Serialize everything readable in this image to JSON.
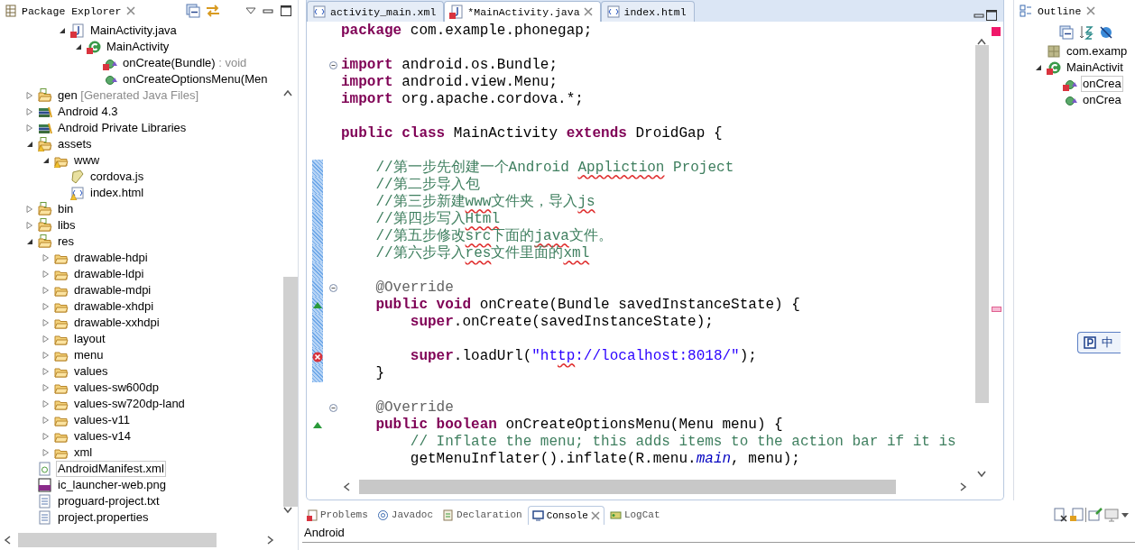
{
  "package_explorer": {
    "title": "Package Explorer",
    "scrolled_items": [
      {
        "label": "MainActivity.java",
        "kind": "java-file",
        "error": true,
        "warning": false,
        "selected": false,
        "expanded": true,
        "children": [
          {
            "label": "MainActivity",
            "kind": "class",
            "error": true,
            "warning": false,
            "selected": false,
            "expanded": true,
            "children": [
              {
                "label": "onCreate(Bundle)",
                "detail": " : void",
                "kind": "method",
                "error": true,
                "warning": false,
                "selected": false
              },
              {
                "label": "onCreateOptionsMenu(Men",
                "kind": "method",
                "error": false,
                "warning": false,
                "selected": false
              }
            ]
          }
        ]
      }
    ],
    "items": [
      {
        "label": "gen",
        "detail": " [Generated Java Files]",
        "kind": "source-folder",
        "error": false,
        "warning": false,
        "selected": false,
        "expanded": false
      },
      {
        "label": "Android 4.3",
        "kind": "library",
        "error": false,
        "warning": false,
        "selected": false,
        "expanded": false
      },
      {
        "label": "Android Private Libraries",
        "kind": "library",
        "error": false,
        "warning": false,
        "selected": false,
        "expanded": false
      },
      {
        "label": "assets",
        "kind": "source-folder",
        "error": false,
        "warning": true,
        "selected": false,
        "expanded": true,
        "children": [
          {
            "label": "www",
            "kind": "folder",
            "error": false,
            "warning": true,
            "selected": false,
            "expanded": true,
            "children": [
              {
                "label": "cordova.js",
                "kind": "js-file",
                "error": false,
                "warning": false,
                "selected": false
              },
              {
                "label": "index.html",
                "kind": "html-file",
                "error": false,
                "warning": true,
                "selected": false
              }
            ]
          }
        ]
      },
      {
        "label": "bin",
        "kind": "source-folder",
        "error": false,
        "warning": false,
        "selected": false,
        "expanded": false
      },
      {
        "label": "libs",
        "kind": "source-folder",
        "error": false,
        "warning": false,
        "selected": false,
        "expanded": false
      },
      {
        "label": "res",
        "kind": "source-folder",
        "error": false,
        "warning": false,
        "selected": false,
        "expanded": true,
        "children": [
          {
            "label": "drawable-hdpi",
            "kind": "folder",
            "error": false,
            "warning": false,
            "selected": false,
            "expanded": false
          },
          {
            "label": "drawable-ldpi",
            "kind": "folder",
            "error": false,
            "warning": false,
            "selected": false,
            "expanded": false
          },
          {
            "label": "drawable-mdpi",
            "kind": "folder",
            "error": false,
            "warning": false,
            "selected": false,
            "expanded": false
          },
          {
            "label": "drawable-xhdpi",
            "kind": "folder",
            "error": false,
            "warning": false,
            "selected": false,
            "expanded": false
          },
          {
            "label": "drawable-xxhdpi",
            "kind": "folder",
            "error": false,
            "warning": false,
            "selected": false,
            "expanded": false
          },
          {
            "label": "layout",
            "kind": "folder",
            "error": false,
            "warning": false,
            "selected": false,
            "expanded": false
          },
          {
            "label": "menu",
            "kind": "folder",
            "error": false,
            "warning": false,
            "selected": false,
            "expanded": false
          },
          {
            "label": "values",
            "kind": "folder",
            "error": false,
            "warning": false,
            "selected": false,
            "expanded": false
          },
          {
            "label": "values-sw600dp",
            "kind": "folder",
            "error": false,
            "warning": false,
            "selected": false,
            "expanded": false
          },
          {
            "label": "values-sw720dp-land",
            "kind": "folder",
            "error": false,
            "warning": false,
            "selected": false,
            "expanded": false
          },
          {
            "label": "values-v11",
            "kind": "folder",
            "error": false,
            "warning": false,
            "selected": false,
            "expanded": false
          },
          {
            "label": "values-v14",
            "kind": "folder",
            "error": false,
            "warning": false,
            "selected": false,
            "expanded": false
          },
          {
            "label": "xml",
            "kind": "folder",
            "error": false,
            "warning": false,
            "selected": false,
            "expanded": false
          }
        ]
      },
      {
        "label": "AndroidManifest.xml",
        "kind": "manifest",
        "error": false,
        "warning": false,
        "selected": true
      },
      {
        "label": "ic_launcher-web.png",
        "kind": "image-file",
        "error": false,
        "warning": false,
        "selected": false
      },
      {
        "label": "proguard-project.txt",
        "kind": "text-file",
        "error": false,
        "warning": false,
        "selected": false
      },
      {
        "label": "project.properties",
        "kind": "text-file",
        "error": false,
        "warning": false,
        "selected": false
      }
    ]
  },
  "editor": {
    "tabs": [
      {
        "label": "activity_main.xml",
        "kind": "xml-file",
        "error": false,
        "selected": false
      },
      {
        "label": "*MainActivity.java",
        "kind": "java-file",
        "error": true,
        "selected": true
      },
      {
        "label": "index.html",
        "kind": "html-file",
        "error": false,
        "selected": false
      }
    ],
    "lines": [
      {
        "kind": "plain",
        "changed": false,
        "tokens": [
          {
            "text": "package",
            "kind": "keyword"
          },
          {
            "text": " com.example.phonegap;",
            "kind": "plain"
          }
        ]
      },
      {
        "kind": "plain",
        "changed": false
      },
      {
        "kind": "fold",
        "changed": false,
        "tokens": [
          {
            "text": "import",
            "kind": "keyword"
          },
          {
            "text": " android.os.Bundle;",
            "kind": "plain"
          }
        ]
      },
      {
        "kind": "plain",
        "changed": false,
        "tokens": [
          {
            "text": "import",
            "kind": "keyword"
          },
          {
            "text": " android.view.Menu;",
            "kind": "plain"
          }
        ]
      },
      {
        "kind": "plain",
        "changed": false,
        "tokens": [
          {
            "text": "import",
            "kind": "keyword"
          },
          {
            "text": " org.apache.cordova.*;",
            "kind": "plain"
          }
        ]
      },
      {
        "kind": "plain",
        "changed": false
      },
      {
        "kind": "plain",
        "changed": false,
        "tokens": [
          {
            "text": "public class",
            "kind": "keyword"
          },
          {
            "text": " MainActivity ",
            "kind": "plain"
          },
          {
            "text": "extends",
            "kind": "keyword"
          },
          {
            "text": " DroidGap {",
            "kind": "plain"
          }
        ]
      },
      {
        "kind": "plain",
        "changed": false
      },
      {
        "kind": "plain",
        "changed": true,
        "tokens": [
          {
            "text": "    //第一步先创建一个Android ",
            "kind": "comment",
            "misspelled": false
          },
          {
            "text": "Appliction",
            "kind": "comment",
            "misspelled": true
          },
          {
            "text": " Project",
            "kind": "comment",
            "misspelled": false
          }
        ]
      },
      {
        "kind": "plain",
        "changed": true,
        "tokens": [
          {
            "text": "    //第二步导入包",
            "kind": "comment",
            "misspelled": false
          }
        ]
      },
      {
        "kind": "plain",
        "changed": true,
        "tokens": [
          {
            "text": "    //第三步新建",
            "kind": "comment",
            "misspelled": false
          },
          {
            "text": "www",
            "kind": "comment",
            "misspelled": true
          },
          {
            "text": "文件夹，导入",
            "kind": "comment",
            "misspelled": false
          },
          {
            "text": "js",
            "kind": "comment",
            "misspelled": true
          }
        ]
      },
      {
        "kind": "plain",
        "changed": true,
        "tokens": [
          {
            "text": "    //第四步写入",
            "kind": "comment",
            "misspelled": false
          },
          {
            "text": "Html",
            "kind": "comment",
            "misspelled": true
          }
        ]
      },
      {
        "kind": "plain",
        "changed": true,
        "tokens": [
          {
            "text": "    //第五步修改",
            "kind": "comment",
            "misspelled": false
          },
          {
            "text": "src",
            "kind": "comment",
            "misspelled": true
          },
          {
            "text": "下面的",
            "kind": "comment",
            "misspelled": false
          },
          {
            "text": "java",
            "kind": "comment",
            "misspelled": true
          },
          {
            "text": "文件。",
            "kind": "comment",
            "misspelled": false
          }
        ]
      },
      {
        "kind": "plain",
        "changed": true,
        "tokens": [
          {
            "text": "    //第六步导入",
            "kind": "comment",
            "misspelled": false
          },
          {
            "text": "res",
            "kind": "comment",
            "misspelled": true
          },
          {
            "text": "文件里面的",
            "kind": "comment",
            "misspelled": false
          },
          {
            "text": "xml",
            "kind": "comment",
            "misspelled": true
          }
        ]
      },
      {
        "kind": "plain",
        "changed": true
      },
      {
        "kind": "fold",
        "changed": true,
        "tokens": [
          {
            "text": "    @Override",
            "kind": "annotation"
          }
        ]
      },
      {
        "kind": "override",
        "changed": true,
        "tokens": [
          {
            "text": "    public void",
            "kind": "keyword"
          },
          {
            "text": " onCreate(Bundle savedInstanceState) {",
            "kind": "plain"
          }
        ]
      },
      {
        "kind": "plain",
        "changed": true,
        "tokens": [
          {
            "text": "        super",
            "kind": "keyword"
          },
          {
            "text": ".onCreate(savedInstanceState);",
            "kind": "plain"
          }
        ]
      },
      {
        "kind": "plain",
        "changed": true
      },
      {
        "kind": "error",
        "changed": true,
        "tokens": [
          {
            "text": "        super",
            "kind": "keyword",
            "misspelled": false
          },
          {
            "text": ".loadUrl(",
            "kind": "plain",
            "misspelled": false
          },
          {
            "text": "\"ht",
            "kind": "string",
            "misspelled": false
          },
          {
            "text": "tp",
            "kind": "string",
            "misspelled": true
          },
          {
            "text": "://localhost:8018/\"",
            "kind": "string",
            "misspelled": false
          },
          {
            "text": ");",
            "kind": "plain",
            "misspelled": false
          }
        ]
      },
      {
        "kind": "plain",
        "changed": true,
        "tokens": [
          {
            "text": "    }",
            "kind": "plain"
          }
        ]
      },
      {
        "kind": "plain",
        "changed": false
      },
      {
        "kind": "fold",
        "changed": false,
        "tokens": [
          {
            "text": "    @Override",
            "kind": "annotation"
          }
        ]
      },
      {
        "kind": "override",
        "changed": false,
        "tokens": [
          {
            "text": "    public boolean",
            "kind": "keyword"
          },
          {
            "text": " onCreateOptionsMenu(Menu menu) {",
            "kind": "plain"
          }
        ]
      },
      {
        "kind": "plain",
        "changed": false,
        "tokens": [
          {
            "text": "        // Inflate the menu; this adds items to the action bar if it is",
            "kind": "comment"
          }
        ]
      },
      {
        "kind": "plain",
        "changed": false,
        "tokens": [
          {
            "text": "        getMenuInflater().inflate(R.menu.",
            "kind": "plain"
          },
          {
            "text": "main",
            "kind": "field"
          },
          {
            "text": ", menu);",
            "kind": "plain"
          }
        ]
      }
    ]
  },
  "outline": {
    "title": "Outline",
    "items": [
      {
        "label": "com.examp",
        "kind": "package",
        "error": false,
        "warning": false,
        "selected": false
      },
      {
        "label": "MainActivit",
        "kind": "class",
        "error": true,
        "warning": false,
        "selected": false,
        "expanded": true,
        "children": [
          {
            "label": "onCrea",
            "kind": "method",
            "error": true,
            "warning": false,
            "selected": true
          },
          {
            "label": "onCrea",
            "kind": "method",
            "error": false,
            "warning": false,
            "selected": false
          }
        ]
      }
    ]
  },
  "ime_bar": {
    "label": "中"
  },
  "console": {
    "tabs": [
      {
        "label": "Problems",
        "kind": "problems",
        "selected": false
      },
      {
        "label": "Javadoc",
        "kind": "javadoc",
        "selected": false
      },
      {
        "label": "Declaration",
        "kind": "declaration",
        "selected": false
      },
      {
        "label": "Console",
        "kind": "console",
        "selected": true
      },
      {
        "label": "LogCat",
        "kind": "logcat",
        "selected": false
      }
    ],
    "label": "Android"
  }
}
